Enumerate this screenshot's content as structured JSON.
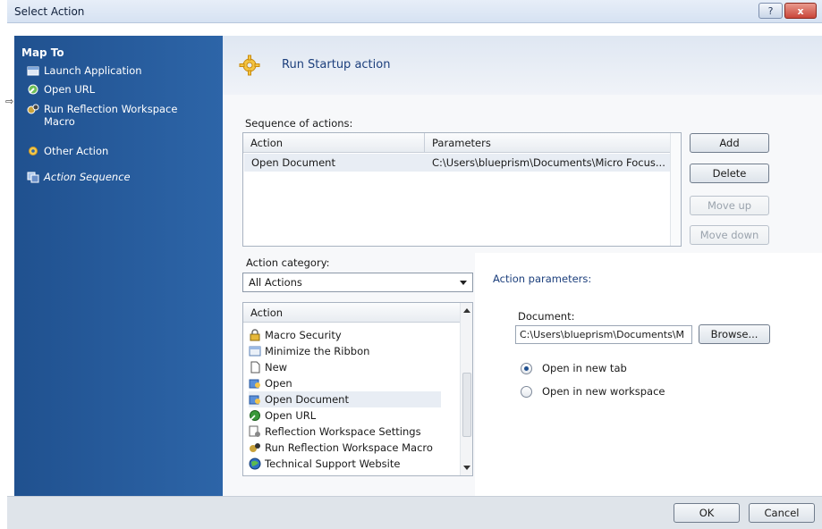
{
  "window": {
    "title": "Select Action",
    "help_label": "?",
    "close_label": "x"
  },
  "sidebar": {
    "heading": "Map To",
    "items": [
      {
        "label": "Launch Application",
        "icon": "launch-app-icon"
      },
      {
        "label": "Open URL",
        "icon": "open-url-icon"
      },
      {
        "label": "Run Reflection Workspace",
        "label2": "Macro",
        "icon": "run-macro-icon"
      },
      {
        "label": "Other Action",
        "icon": "gear-icon"
      },
      {
        "label": "Action Sequence",
        "icon": "action-sequence-icon"
      }
    ],
    "marker": "⇨"
  },
  "header": {
    "title": "Run Startup action"
  },
  "sequence": {
    "label": "Sequence of actions:",
    "columns": [
      "Action",
      "Parameters"
    ],
    "rows": [
      {
        "action": "Open Document",
        "parameters": "C:\\Users\\blueprism\\Documents\\Micro Focus..."
      }
    ]
  },
  "buttons": {
    "add": "Add",
    "delete": "Delete",
    "move_up": "Move up",
    "move_down": "Move down",
    "browse": "Browse...",
    "ok": "OK",
    "cancel": "Cancel"
  },
  "category": {
    "label": "Action category:",
    "selected": "All Actions",
    "list_header": "Action",
    "items": [
      {
        "label": "Macro Security",
        "icon": "lock-icon"
      },
      {
        "label": "Minimize the Ribbon",
        "icon": "ribbon-icon"
      },
      {
        "label": "New",
        "icon": "new-document-icon"
      },
      {
        "label": "Open",
        "icon": "open-icon"
      },
      {
        "label": "Open Document",
        "icon": "open-document-icon",
        "selected": true
      },
      {
        "label": "Open URL",
        "icon": "open-url-icon"
      },
      {
        "label": "Reflection Workspace Settings",
        "icon": "settings-icon"
      },
      {
        "label": "Run Reflection Workspace Macro",
        "icon": "run-macro-icon"
      },
      {
        "label": "Technical Support Website",
        "icon": "globe-icon"
      }
    ]
  },
  "params": {
    "title": "Action parameters:",
    "document_label": "Document:",
    "document_value": "C:\\Users\\blueprism\\Documents\\M",
    "radio_new_tab": "Open in new tab",
    "radio_new_workspace": "Open in new workspace",
    "selected_radio": "new_tab"
  },
  "colors": {
    "sidebar": "#2d65a8",
    "accent_text": "#1c3f7c",
    "selection": "#e8edf4"
  }
}
